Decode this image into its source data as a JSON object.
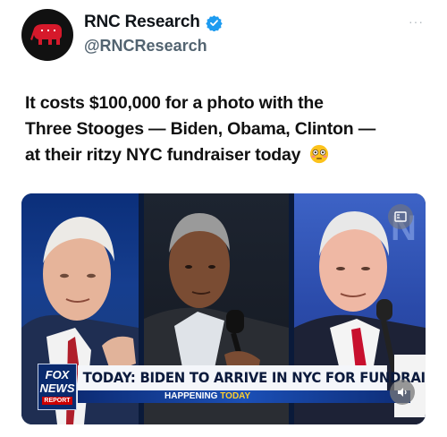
{
  "author": {
    "name": "RNC Research",
    "handle": "@RNCResearch"
  },
  "more_menu": "···",
  "tweet": {
    "line1": "It costs $100,000 for a photo with the",
    "line2": "Three Stooges — Biden, Obama, Clinton —",
    "line3": "at their ritzy NYC fundraiser today"
  },
  "media": {
    "network_logo": [
      "FOX",
      "NEWS",
      "REPORT"
    ],
    "headline": "TODAY: BIDEN TO ARRIVE IN NYC FOR FUNDRAISER",
    "subline_a": "HAPPENING ",
    "subline_b": "TODAY"
  },
  "colors": {
    "brand_red": "#d6192b",
    "verified_blue": "#1d9bf0",
    "handle_gray": "#536471"
  }
}
